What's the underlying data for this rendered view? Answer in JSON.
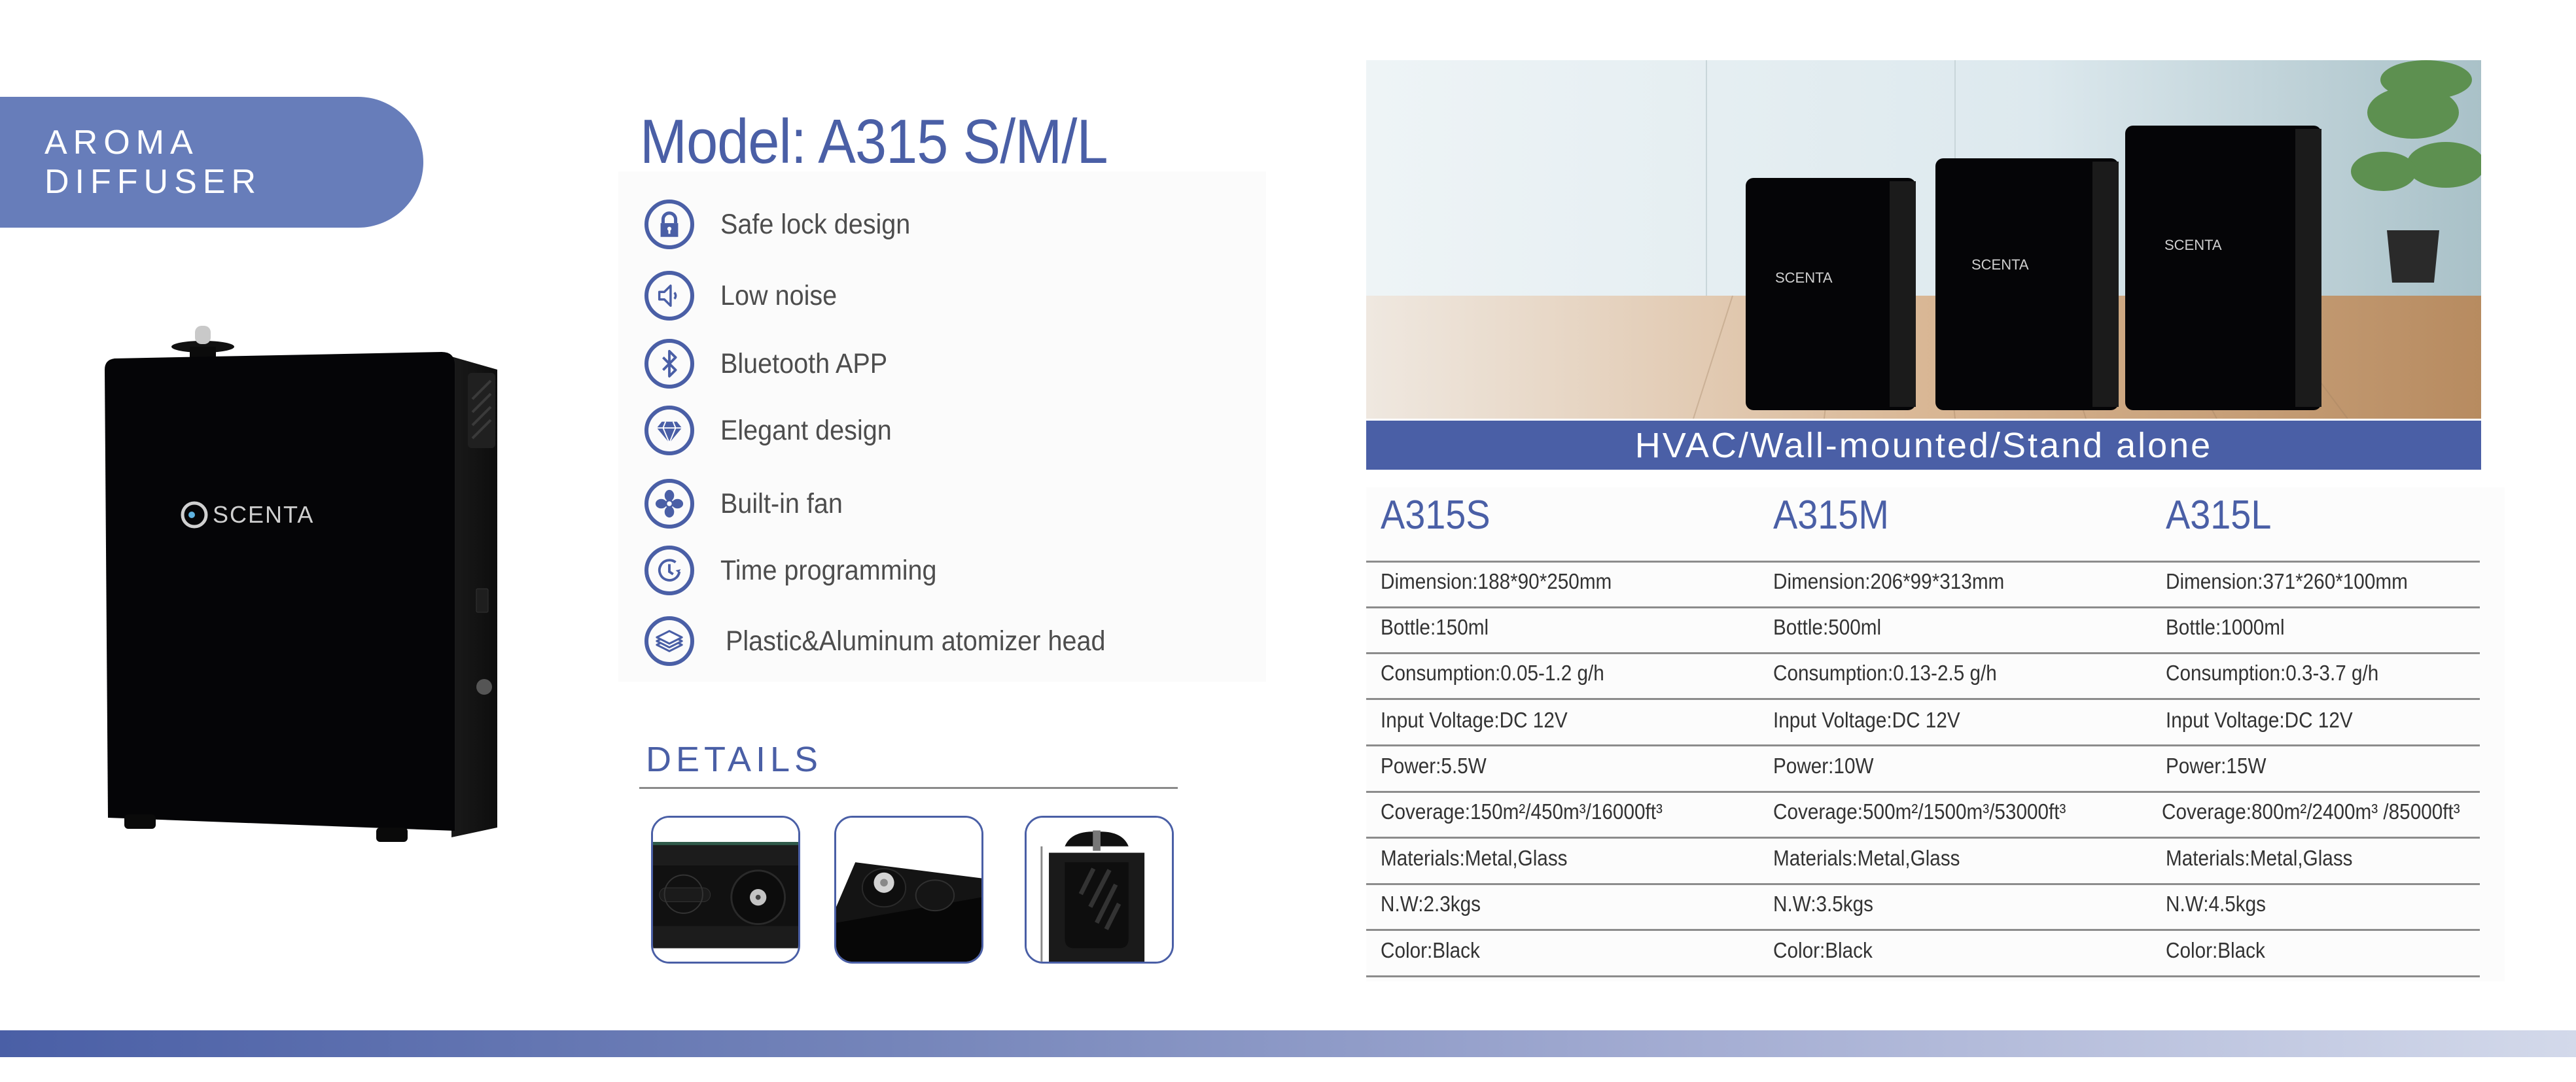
{
  "category_label": "AROMA DIFFUSER",
  "model_title": "Model: A315 S/M/L",
  "brand_logo_text": "SCENTA",
  "features": [
    {
      "icon": "lock-icon",
      "label": "Safe lock design"
    },
    {
      "icon": "speaker-low-icon",
      "label": "Low noise"
    },
    {
      "icon": "bluetooth-icon",
      "label": "Bluetooth APP"
    },
    {
      "icon": "diamond-icon",
      "label": "Elegant design"
    },
    {
      "icon": "fan-icon",
      "label": "Built-in fan"
    },
    {
      "icon": "clock-icon",
      "label": "Time programming"
    },
    {
      "icon": "layers-icon",
      "label": "Plastic&Aluminum atomizer head"
    }
  ],
  "details": {
    "title": "DETAILS",
    "thumbnails": [
      {
        "name": "detail-lock-and-nozzle"
      },
      {
        "name": "detail-atomizer-head"
      },
      {
        "name": "detail-fan-vent"
      }
    ]
  },
  "installation_banner": "HVAC/Wall-mounted/Stand alone",
  "specs": {
    "models": [
      "A315S",
      "A315M",
      "A315L"
    ],
    "rows": [
      [
        "Dimension:188*90*250mm",
        "Dimension:206*99*313mm",
        "Dimension:371*260*100mm"
      ],
      [
        "Bottle:150ml",
        "Bottle:500ml",
        "Bottle:1000ml"
      ],
      [
        "Consumption:0.05-1.2 g/h",
        "Consumption:0.13-2.5 g/h",
        "Consumption:0.3-3.7 g/h"
      ],
      [
        "Input Voltage:DC 12V",
        "Input Voltage:DC 12V",
        "Input Voltage:DC 12V"
      ],
      [
        "Power:5.5W",
        "Power:10W",
        "Power:15W"
      ],
      [
        "Coverage:150m²/450m³/16000ft³",
        "Coverage:500m²/1500m³/53000ft³",
        "Coverage:800m²/2400m³ /85000ft³"
      ],
      [
        "Materials:Metal,Glass",
        "Materials:Metal,Glass",
        "Materials:Metal,Glass"
      ],
      [
        "N.W:2.3kgs",
        "N.W:3.5kgs",
        "N.W:4.5kgs"
      ],
      [
        "Color:Black",
        "Color:Black",
        "Color:Black"
      ]
    ]
  },
  "colors": {
    "brand_blue": "#4A5FA6",
    "pill_blue": "#677DBA",
    "text_gray": "#4d4d4d"
  }
}
